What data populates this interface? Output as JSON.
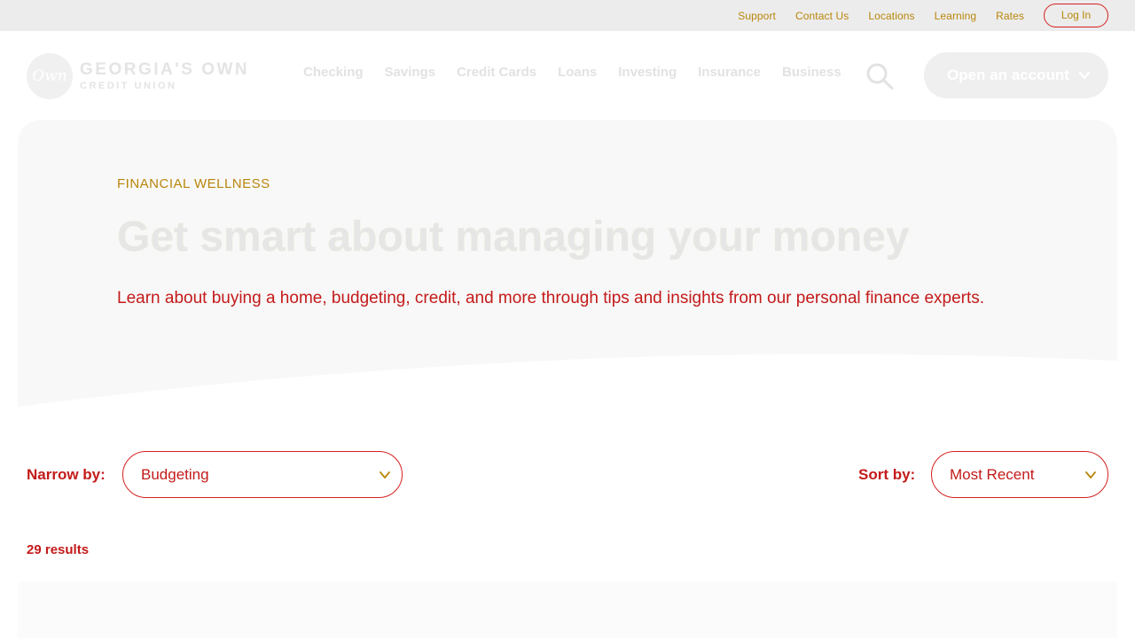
{
  "utility": {
    "links": [
      "Support",
      "Contact Us",
      "Locations",
      "Learning",
      "Rates"
    ],
    "login_label": "Log In"
  },
  "logo": {
    "mark": "Own",
    "line1": "GEORGIA'S OWN",
    "line2": "CREDIT UNION"
  },
  "nav": {
    "items": [
      "Checking",
      "Savings",
      "Credit Cards",
      "Loans",
      "Investing",
      "Insurance",
      "Business"
    ],
    "search_icon": "search-icon",
    "open_account_label": "Open an account"
  },
  "hero": {
    "eyebrow": "FINANCIAL WELLNESS",
    "title": "Get smart about managing your money",
    "description": "Learn about buying a home, budgeting, credit, and more through tips and insights from our personal finance experts."
  },
  "filters": {
    "narrow_label": "Narrow by:",
    "narrow_value": "Budgeting",
    "sort_label": "Sort by:",
    "sort_value": "Most Recent"
  },
  "results": {
    "count_text": "29 results"
  },
  "colors": {
    "accent_red": "#d62020",
    "gold": "#b8860b",
    "hero_bg": "#f8f8f8"
  }
}
